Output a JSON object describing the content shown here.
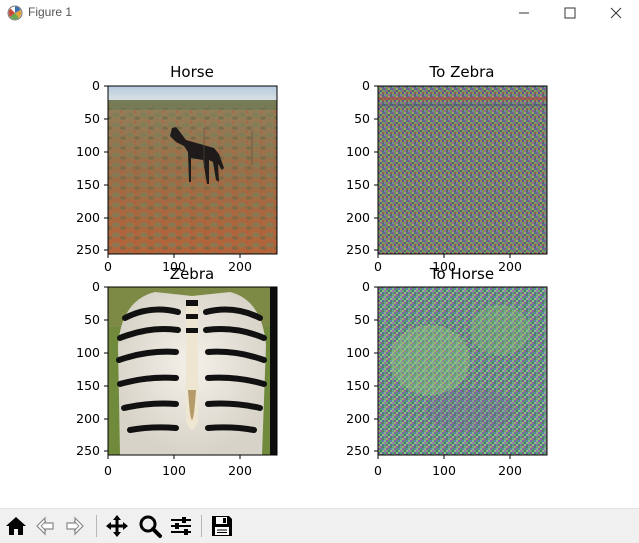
{
  "window": {
    "title": "Figure 1",
    "minimize_icon": "minimize-icon",
    "maximize_icon": "maximize-icon",
    "close_icon": "close-icon"
  },
  "axes": [
    {
      "id": "horse",
      "title": "Horse",
      "image": "photo of a dark horse standing in dry red-soil scrubland"
    },
    {
      "id": "to-zebra",
      "title": "To Zebra",
      "image": "noisy multicolor generated image"
    },
    {
      "id": "zebra",
      "title": "Zebra",
      "image": "photo of a zebra seen from behind on grass"
    },
    {
      "id": "to-horse",
      "title": "To Horse",
      "image": "noisy green-purple generated image"
    }
  ],
  "ticks": {
    "x": [
      "0",
      "100",
      "200"
    ],
    "y": [
      "0",
      "50",
      "100",
      "150",
      "200",
      "250"
    ]
  },
  "toolbar": {
    "buttons": [
      {
        "name": "home",
        "icon": "home-icon"
      },
      {
        "name": "back",
        "icon": "back-arrow-icon"
      },
      {
        "name": "forward",
        "icon": "forward-arrow-icon"
      },
      {
        "name": "pan",
        "icon": "move-icon"
      },
      {
        "name": "zoom",
        "icon": "zoom-icon"
      },
      {
        "name": "configure",
        "icon": "sliders-icon"
      },
      {
        "name": "save",
        "icon": "save-icon"
      }
    ]
  }
}
